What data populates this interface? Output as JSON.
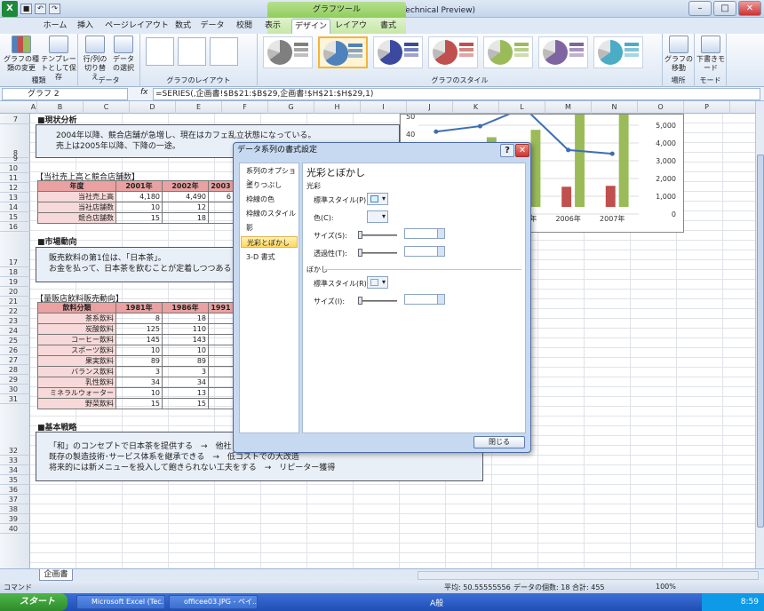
{
  "app": {
    "title": "第3章.xlsx - Microsoft Excel (Technical Preview)"
  },
  "tabs": [
    "ホーム",
    "挿入",
    "ページレイアウト",
    "数式",
    "データ",
    "校閲",
    "表示",
    "デザイン",
    "レイアウト",
    "書式"
  ],
  "context_tab_header": "グラフツール",
  "ribbon": {
    "groups": [
      {
        "label": "種類",
        "buttons": [
          "グラフの種類の変更",
          "テンプレートとして保存"
        ]
      },
      {
        "label": "データ",
        "buttons": [
          "行/列の切り替え",
          "データの選択"
        ]
      },
      {
        "label": "グラフのレイアウト"
      },
      {
        "label": "グラフのスタイル"
      },
      {
        "label": "場所",
        "buttons": [
          "グラフの移動"
        ]
      },
      {
        "label": "モード",
        "buttons": [
          "下書きモード"
        ]
      }
    ],
    "style_colors": [
      "#7f7f7f",
      "#4f81bd",
      "#3b4aa0",
      "#c0504d",
      "#9bbb59",
      "#8064a2",
      "#4bacc6"
    ]
  },
  "formula_bar": {
    "namebox": "グラフ 2",
    "fx": "fx",
    "formula": "=SERIES(,企画書!$B$21:$B$29,企画書!$H$21:$H$29,1)"
  },
  "columns": [
    "A",
    "B",
    "C",
    "D",
    "E",
    "F",
    "G",
    "H",
    "I",
    "J",
    "K",
    "L",
    "M",
    "N",
    "O",
    "P"
  ],
  "rows": [
    "7",
    "8",
    "9",
    "10",
    "11",
    "12",
    "13",
    "14",
    "15",
    "16",
    "17",
    "18",
    "19",
    "20",
    "21",
    "22",
    "23",
    "24",
    "25",
    "26",
    "27",
    "28",
    "29",
    "30",
    "31",
    "32",
    "33",
    "34",
    "35",
    "36",
    "37",
    "38",
    "39",
    "40"
  ],
  "sections": {
    "analysis_title": "■現状分析",
    "analysis_text": [
      "2004年以降、競合店舗が急増し、現在はカフェ乱立状態になっている。",
      "売上は2005年以降、下降の一途。"
    ],
    "sales_title": "【当社売上高と競合店舗数】",
    "market_title": "■市場動向",
    "market_text": [
      "販売飲料の第1位は、「日本茶」。",
      "お金を払って、日本茶を飲むことが定着しつつある"
    ],
    "vending_title": "【量販店飲料販売動向】",
    "strategy_title": "■基本戦略",
    "strategy_text": [
      "「和」のコンセプトで日本茶を提供する　→　他社と",
      "既存の製造技術･サービス体系を継承できる　→　低コストでの大改造",
      "将来的には新メニューを投入して飽きられない工夫をする　→　リピーター獲得"
    ]
  },
  "sales_table": {
    "headers": [
      "年度",
      "2001年",
      "2002年",
      "2003"
    ],
    "rows": [
      [
        "当社売上高",
        "4,180",
        "4,490",
        "6"
      ],
      [
        "当社店舗数",
        "10",
        "12",
        ""
      ],
      [
        "競合店舗数",
        "15",
        "18",
        ""
      ]
    ]
  },
  "vending_table": {
    "headers": [
      "飲料分類",
      "1981年",
      "1986年",
      "1991"
    ],
    "rows": [
      [
        "茶系飲料",
        "8",
        "18"
      ],
      [
        "炭酸飲料",
        "125",
        "110"
      ],
      [
        "コーヒー飲料",
        "145",
        "143"
      ],
      [
        "スポーツ飲料",
        "10",
        "10"
      ],
      [
        "果実飲料",
        "89",
        "89"
      ],
      [
        "バランス飲料",
        "3",
        "3"
      ],
      [
        "乳性飲料",
        "34",
        "34"
      ],
      [
        "ミネラルウォーター",
        "10",
        "13"
      ],
      [
        "野菜飲料",
        "15",
        "15"
      ]
    ]
  },
  "chart_data": {
    "type": "bar",
    "categories": [
      "2003年",
      "2004年",
      "2005年",
      "2006年",
      "2007年"
    ],
    "y_right_ticks": [
      "5,000",
      "4,000",
      "3,000",
      "2,000",
      "1,000",
      "0"
    ],
    "y_left_ticks": [
      "50",
      "40",
      "30",
      "20"
    ],
    "x_labels_visible": [
      "004年",
      "2005年",
      "2006年",
      "2007年"
    ],
    "series": [
      {
        "values": [
          1200,
          1300,
          1250,
          1100,
          1150
        ],
        "color": "#c0504d"
      },
      {
        "values": [
          3000,
          3800,
          4200,
          6000,
          6000
        ],
        "color": "#9bbb59"
      }
    ],
    "line": {
      "values": [
        4100,
        4400,
        5400,
        3100,
        2900
      ],
      "color": "#3e6eb0"
    },
    "ylim": [
      0,
      6000
    ]
  },
  "dialog": {
    "title": "データ系列の書式設定",
    "nav": [
      "系列のオプション",
      "塗りつぶし",
      "枠線の色",
      "枠線のスタイル",
      "影",
      "光彩とぼかし",
      "3-D 書式"
    ],
    "selected_nav": "光彩とぼかし",
    "panel_title": "光彩とぼかし",
    "glow_section": "光彩",
    "glow_preset": "標準スタイル(P):",
    "glow_color": "色(C):",
    "glow_size": "サイズ(S):",
    "glow_transparency": "透過性(T):",
    "soft_section": "ぼかし",
    "soft_preset": "標準スタイル(R):",
    "soft_size": "サイズ(I):",
    "close_label": "閉じる"
  },
  "sheet": {
    "tab": "企画書"
  },
  "status": {
    "mode": "コマンド",
    "average": "平均: 50.55555556",
    "count": "データの個数: 18",
    "sum": "合計: 455",
    "zoom": "100%"
  },
  "taskbar": {
    "start": "スタート",
    "items": [
      "Microsoft Excel (Tec...",
      "officee03.JPG - ペイ..."
    ],
    "ime": "A般",
    "clock": "8:59"
  }
}
